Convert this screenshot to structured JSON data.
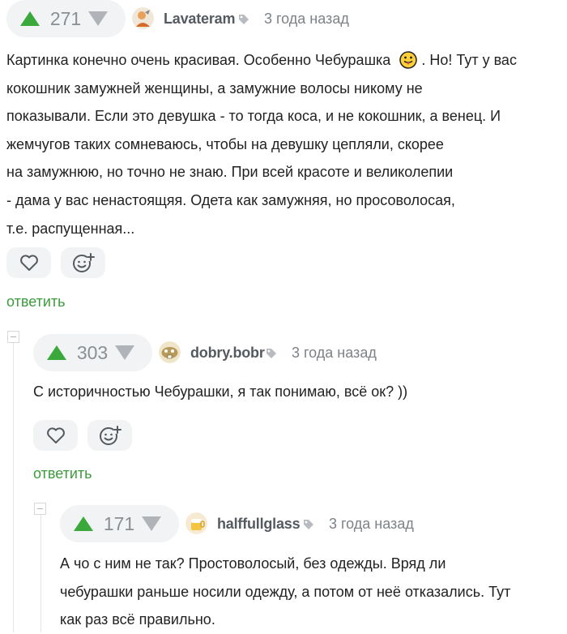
{
  "comments": [
    {
      "rating": "271",
      "author": "Lavateram",
      "time": "3 года назад",
      "lines": [
        "Картинка конечно очень красивая. Особенно Чебурашка",
        "кокошник замужней женщины, а замужние волосы никому не",
        "показывали. Если это девушка - то тогда коса, и не кокошник, а венец. И",
        "жемчугов таких сомневаюсь, чтобы на девушку цепляли, скорее",
        "на замужнюю, но точно не знаю. При всей красоте и великолепии",
        "- дама у вас ненастоящяя. Одета как замужняя, но просоволосая,",
        "т.е. распущенная..."
      ],
      "line1_tail": ". Но! Тут у вас",
      "reply": "ответить"
    },
    {
      "rating": "303",
      "author": "dobry.bobr",
      "time": "3 года назад",
      "lines": [
        "С историчностью Чебурашки, я так понимаю, всё ок? ))"
      ],
      "reply": "ответить"
    },
    {
      "rating": "171",
      "author": "halffullglass",
      "time": "3 года назад",
      "lines": [
        "А чо с ним не так? Простоволосый, без одежды. Вряд ли",
        "чебурашки раньше носили одежду, а потом от неё отказались. Тут",
        "как раз всё правильно."
      ]
    }
  ],
  "colors": {
    "upvote": "#3aa83a",
    "reply": "#3d9a3d",
    "pill": "#f2f3f4"
  },
  "icons": [
    "arrow-up-icon",
    "arrow-down-icon",
    "tag-icon",
    "heart-icon",
    "add-emoji-icon",
    "tongue-emoji-icon"
  ]
}
